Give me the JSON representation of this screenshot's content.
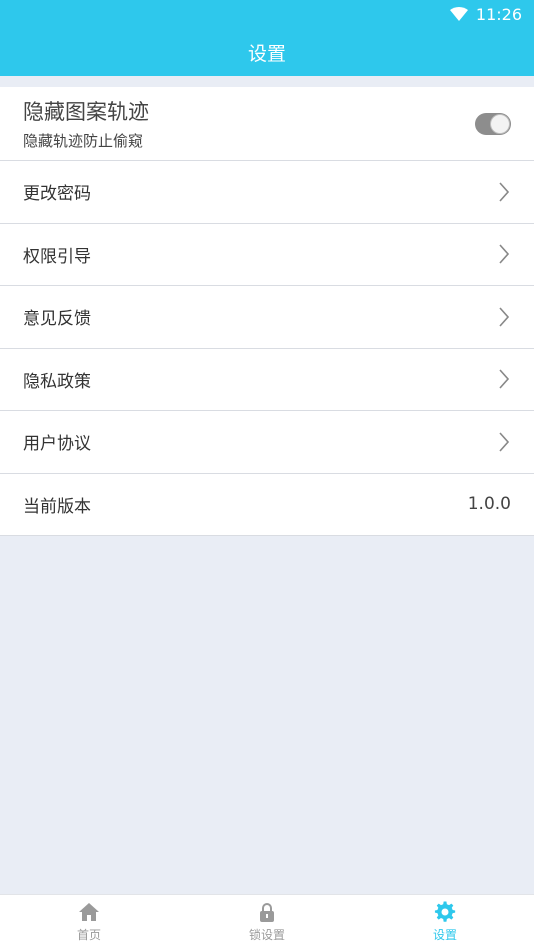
{
  "status_bar": {
    "time": "11:26"
  },
  "app_bar": {
    "title": "设置"
  },
  "settings": {
    "hide_track": {
      "title": "隐藏图案轨迹",
      "subtitle": "隐藏轨迹防止偷窥",
      "enabled": true
    },
    "items": [
      {
        "label": "更改密码"
      },
      {
        "label": "权限引导"
      },
      {
        "label": "意见反馈"
      },
      {
        "label": "隐私政策"
      },
      {
        "label": "用户协议"
      }
    ],
    "version": {
      "label": "当前版本",
      "value": "1.0.0"
    }
  },
  "tabs": [
    {
      "label": "首页",
      "icon": "home-icon",
      "active": false
    },
    {
      "label": "锁设置",
      "icon": "lock-icon",
      "active": false
    },
    {
      "label": "设置",
      "icon": "gear-icon",
      "active": true
    }
  ],
  "colors": {
    "primary": "#2ec8ec",
    "background": "#e9edf5",
    "toggle": "#8d8d8d"
  }
}
